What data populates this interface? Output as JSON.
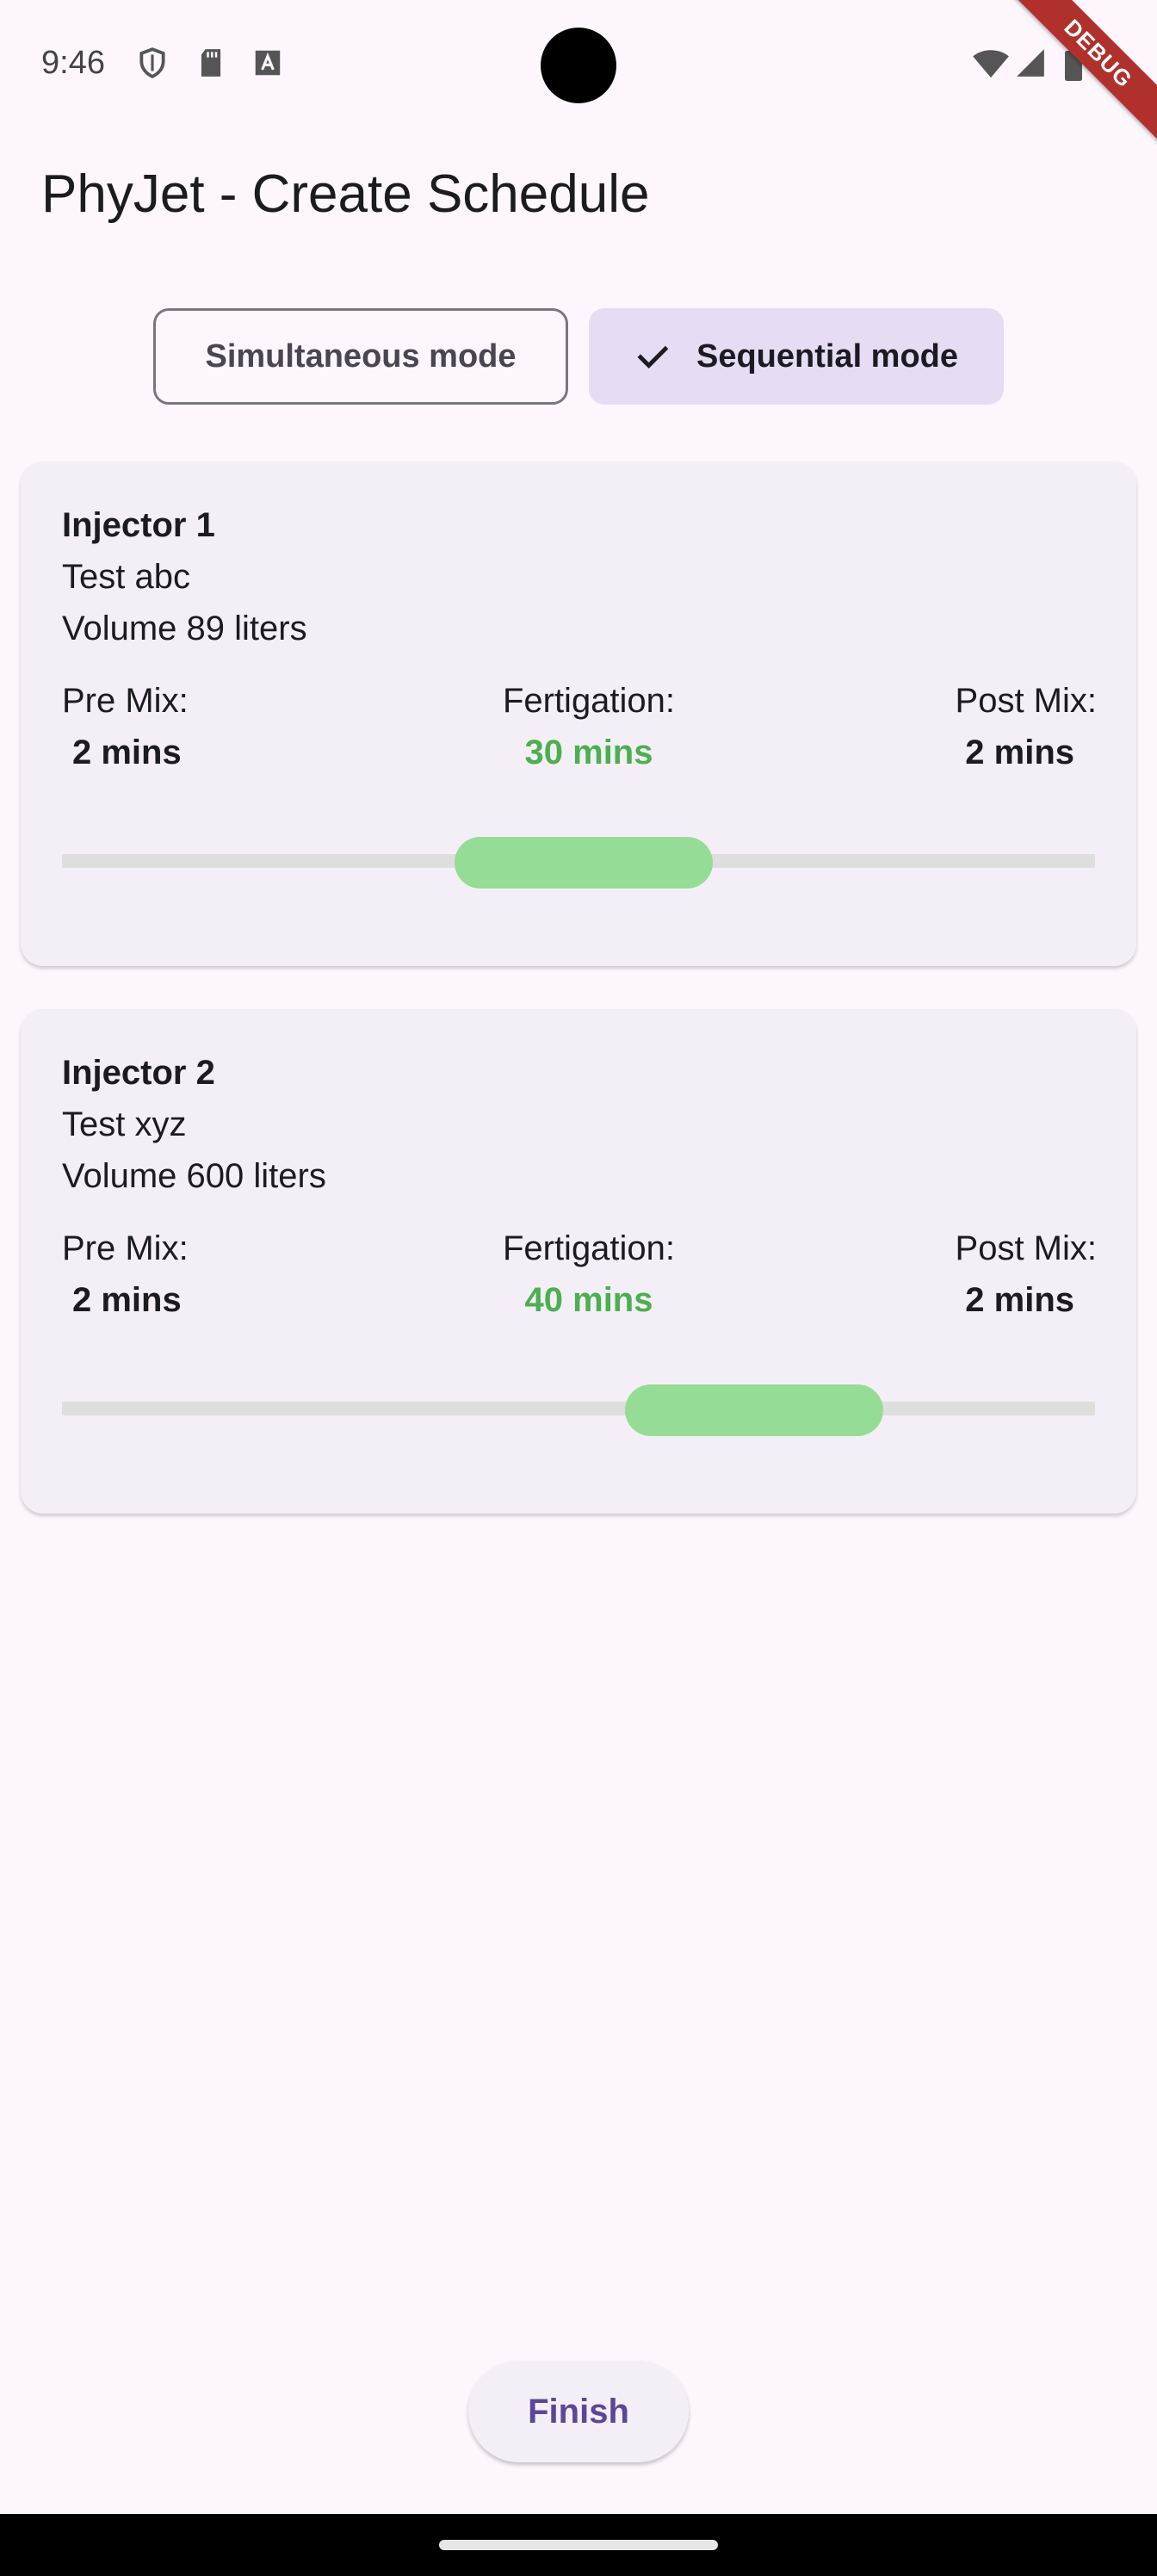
{
  "status_bar": {
    "time": "9:46",
    "icons": [
      "shield-icon",
      "sd-card-icon",
      "font-a-icon",
      "wifi-icon",
      "signal-icon",
      "battery-icon"
    ],
    "debug_banner": "DEBUG"
  },
  "app_bar": {
    "title": "PhyJet - Create Schedule"
  },
  "mode_selector": {
    "options": [
      {
        "label": "Simultaneous mode",
        "selected": false
      },
      {
        "label": "Sequential mode",
        "selected": true
      }
    ]
  },
  "injectors": [
    {
      "title": "Injector 1",
      "name": "Test abc",
      "volume": "Volume 89 liters",
      "pre_mix_label": "Pre Mix:",
      "pre_mix_value": "2 mins",
      "fertigation_label": "Fertigation:",
      "fertigation_value": "30 mins",
      "post_mix_label": "Post Mix:",
      "post_mix_value": "2 mins",
      "timeline_start_fraction": 0.38,
      "timeline_end_fraction": 0.63
    },
    {
      "title": "Injector 2",
      "name": "Test xyz",
      "volume": "Volume 600 liters",
      "pre_mix_label": "Pre Mix:",
      "pre_mix_value": "2 mins",
      "fertigation_label": "Fertigation:",
      "fertigation_value": "40 mins",
      "post_mix_label": "Post Mix:",
      "post_mix_value": "2 mins",
      "timeline_start_fraction": 0.545,
      "timeline_end_fraction": 0.795
    }
  ],
  "footer": {
    "finish_label": "Finish"
  },
  "colors": {
    "accent": "#5a4796",
    "fertigation_text": "#4caf50",
    "range_fill": "#95dc96",
    "background": "#fdf7fd"
  }
}
